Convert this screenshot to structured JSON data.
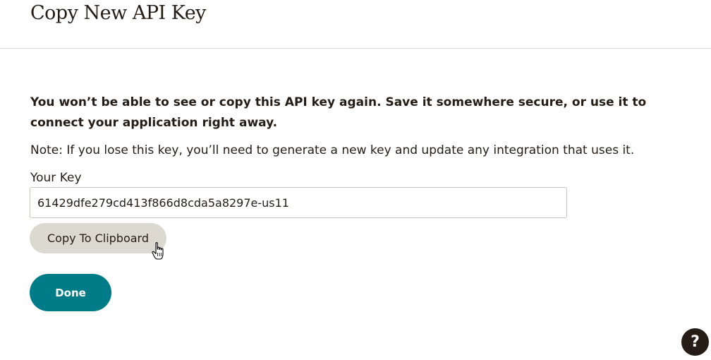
{
  "header": {
    "title": "Copy New API Key"
  },
  "main": {
    "warning": "You won’t be able to see or copy this API key again. Save it somewhere secure, or use it to connect your application right away.",
    "note": "Note: If you lose this key, you’ll need to generate a new key and update any integration that uses it.",
    "key_label": "Your Key",
    "key_value": "61429dfe279cd413f866d8cda5a8297e-us11",
    "copy_button_label": "Copy To Clipboard",
    "done_button_label": "Done"
  },
  "help": {
    "label": "?"
  },
  "colors": {
    "text": "#241c15",
    "primary_button": "#007c89",
    "secondary_button": "#dcd9d1",
    "help_button": "#241c15"
  },
  "icons": {
    "cursor": "hand-pointer-cursor-icon",
    "help": "question-mark-icon"
  }
}
